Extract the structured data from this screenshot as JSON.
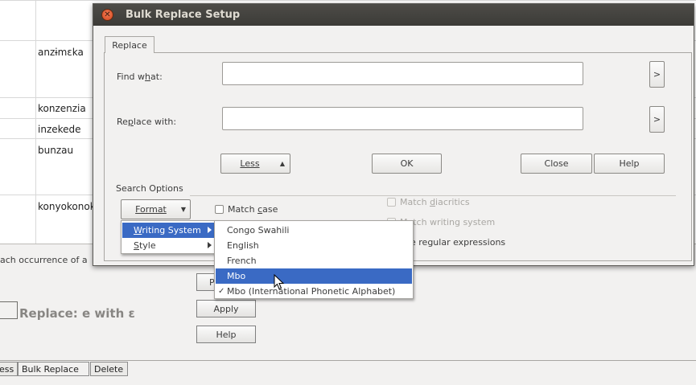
{
  "background": {
    "words": [
      "anzɨmɛka",
      "konzenzia",
      "inzekede",
      "bunzau",
      "konyokonok"
    ],
    "status_text": "ach occurrence of a",
    "rule_label": "Replace: e with ɛ",
    "buttons": {
      "partial": "P",
      "apply": "Apply",
      "help": "Help"
    },
    "tabs": [
      "ess",
      "Bulk Replace",
      "Delete"
    ]
  },
  "dialog": {
    "title": "Bulk Replace Setup",
    "tab": "Replace",
    "find_label": "Find what:",
    "find_value": "",
    "replace_label": "Replace with:",
    "replace_value": "",
    "arrow_label": ">",
    "less_label": "Less",
    "ok_label": "OK",
    "close_label": "Close",
    "help_label": "Help",
    "search_options_label": "Search Options",
    "format_label": "Format",
    "match_case": {
      "label": "Match case",
      "checked": false
    },
    "match_diacritics": {
      "label": "Match diacritics",
      "enabled": false
    },
    "match_writing_system": {
      "label": "Match writing system",
      "enabled": false
    },
    "regex": {
      "label": "Use regular expressions",
      "visible_text": "e regular expressions"
    }
  },
  "format_menu": {
    "items": [
      {
        "label": "Writing System",
        "active": true
      },
      {
        "label": "Style",
        "active": false
      }
    ]
  },
  "writing_system_menu": {
    "items": [
      {
        "label": "Congo Swahili",
        "checked": false,
        "active": false
      },
      {
        "label": "English",
        "checked": false,
        "active": false
      },
      {
        "label": "French",
        "checked": false,
        "active": false
      },
      {
        "label": "Mbo",
        "checked": false,
        "active": true
      },
      {
        "label": "Mbo (International Phonetic Alphabet)",
        "checked": true,
        "active": false
      }
    ]
  },
  "colors": {
    "accent": "#3a6ac4",
    "titlebar": "#3c3b37",
    "close_button": "#e05a2b"
  }
}
